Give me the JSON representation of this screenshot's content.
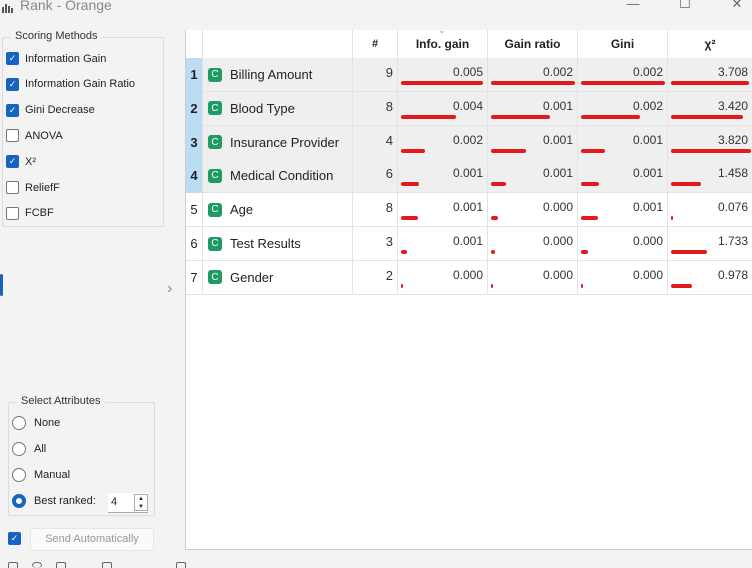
{
  "window": {
    "title": "Rank - Orange",
    "controls": [
      "minimize",
      "maximize",
      "close"
    ]
  },
  "scoring_methods": {
    "title": "Scoring Methods",
    "items": [
      {
        "label": "Information Gain",
        "checked": true
      },
      {
        "label": "Information Gain Ratio",
        "checked": true
      },
      {
        "label": "Gini Decrease",
        "checked": true
      },
      {
        "label": "ANOVA",
        "checked": false
      },
      {
        "label": "X²",
        "checked": true
      },
      {
        "label": "ReliefF",
        "checked": false
      },
      {
        "label": "FCBF",
        "checked": false
      }
    ]
  },
  "select_attributes": {
    "title": "Select Attributes",
    "options": [
      {
        "label": "None",
        "selected": false
      },
      {
        "label": "All",
        "selected": false
      },
      {
        "label": "Manual",
        "selected": false
      },
      {
        "label": "Best ranked:",
        "selected": true
      }
    ],
    "best_ranked_value": "4"
  },
  "send": {
    "label": "Send Automatically",
    "checked": true
  },
  "table": {
    "headers": [
      "",
      "",
      "#",
      "Info. gain",
      "Gain ratio",
      "Gini",
      "χ²"
    ],
    "sort_indicator": "chevron-down",
    "rows": [
      {
        "idx": "1",
        "type": "C",
        "name": "Billing Amount",
        "n": "9",
        "info": "0.005",
        "ratio": "0.002",
        "gini": "0.002",
        "chi": "3.708",
        "bars": [
          0.98,
          1.0,
          1.0,
          0.97
        ],
        "selected": true
      },
      {
        "idx": "2",
        "type": "C",
        "name": "Blood Type",
        "n": "8",
        "info": "0.004",
        "ratio": "0.001",
        "gini": "0.002",
        "chi": "3.420",
        "bars": [
          0.66,
          0.7,
          0.7,
          0.9
        ],
        "selected": true
      },
      {
        "idx": "3",
        "type": "C",
        "name": "Insurance Provider",
        "n": "4",
        "info": "0.002",
        "ratio": "0.001",
        "gini": "0.001",
        "chi": "3.820",
        "bars": [
          0.28,
          0.42,
          0.28,
          1.0
        ],
        "selected": true
      },
      {
        "idx": "4",
        "type": "C",
        "name": "Medical Condition",
        "n": "6",
        "info": "0.001",
        "ratio": "0.001",
        "gini": "0.001",
        "chi": "1.458",
        "bars": [
          0.22,
          0.18,
          0.22,
          0.38
        ],
        "selected": true
      },
      {
        "idx": "5",
        "type": "C",
        "name": "Age",
        "n": "8",
        "info": "0.001",
        "ratio": "0.000",
        "gini": "0.001",
        "chi": "0.076",
        "bars": [
          0.2,
          0.08,
          0.2,
          0.02
        ],
        "selected": false
      },
      {
        "idx": "6",
        "type": "C",
        "name": "Test Results",
        "n": "3",
        "info": "0.001",
        "ratio": "0.000",
        "gini": "0.000",
        "chi": "1.733",
        "bars": [
          0.07,
          0.05,
          0.08,
          0.45
        ],
        "selected": false
      },
      {
        "idx": "7",
        "type": "C",
        "name": "Gender",
        "n": "2",
        "info": "0.000",
        "ratio": "0.000",
        "gini": "0.000",
        "chi": "0.978",
        "bars": [
          0.01,
          0.01,
          0.02,
          0.26
        ],
        "selected": false
      }
    ]
  },
  "colors": {
    "accent": "#1565c0",
    "bar": "#e31a1c",
    "selected_row": "#bcdcf4",
    "continuous_icon": "#1e9a64"
  }
}
